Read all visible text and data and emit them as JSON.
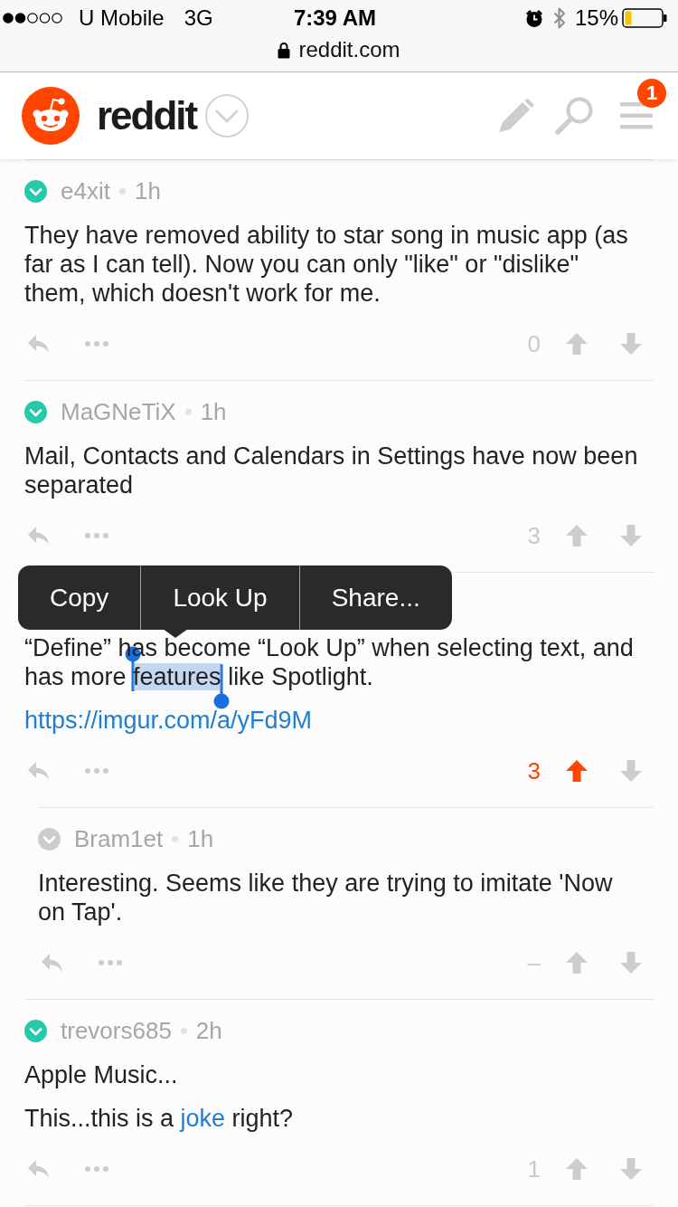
{
  "status_bar": {
    "carrier": "U Mobile",
    "network": "3G",
    "time": "7:39 AM",
    "battery": "15%"
  },
  "address_bar": {
    "url": "reddit.com"
  },
  "header": {
    "logo_text": "reddit",
    "notification_count": "1"
  },
  "comments": [
    {
      "author": "e4xit",
      "time": "1h",
      "color": "#25c9ad",
      "paragraphs": [
        {
          "parts": [
            {
              "kind": "text",
              "text": "They have removed ability to star song in music app (as far as I can tell). Now you can only \"like\" or \"dislike\" them, which doesn't work for me.",
              "selected": false
            }
          ]
        }
      ],
      "score": "0",
      "upvoted": false
    },
    {
      "author": "MaGNeTiX",
      "time": "1h",
      "color": "#25c9ad",
      "paragraphs": [
        {
          "parts": [
            {
              "kind": "text",
              "text": "Mail, Contacts and Calendars in Settings have now been separated",
              "selected": false
            }
          ]
        }
      ],
      "score": "3",
      "upvoted": false
    },
    {
      "context_menu": {
        "items": [
          "Copy",
          "Look Up",
          "Share..."
        ]
      },
      "paragraphs": [
        {
          "parts": [
            {
              "kind": "text",
              "text": "“Define” has become “Look Up” when selecting text, and has more ",
              "selected": false
            },
            {
              "kind": "text",
              "text": "features",
              "selected": true
            },
            {
              "kind": "text",
              "text": " like Spotlight.",
              "selected": false
            }
          ]
        },
        {
          "parts": [
            {
              "kind": "link",
              "text": "https://imgur.com/a/yFd9M",
              "selected": false
            }
          ]
        }
      ],
      "score": "3",
      "upvoted": true,
      "children": [
        {
          "author": "Bram1et",
          "time": "1h",
          "color": "#cccccc",
          "paragraphs": [
            {
              "parts": [
                {
                  "kind": "text",
                  "text": "Interesting. Seems like they are trying to imitate 'Now on Tap'.",
                  "selected": false
                }
              ]
            }
          ],
          "score": "–",
          "upvoted": false
        }
      ]
    },
    {
      "author": "trevors685",
      "time": "2h",
      "color": "#25c9ad",
      "paragraphs": [
        {
          "parts": [
            {
              "kind": "text",
              "text": "Apple Music...",
              "selected": false
            }
          ]
        },
        {
          "parts": [
            {
              "kind": "text",
              "text": "This...this is a ",
              "selected": false
            },
            {
              "kind": "link",
              "text": "joke",
              "selected": false
            },
            {
              "kind": "text",
              "text": " right?",
              "selected": false
            }
          ]
        }
      ],
      "score": "1",
      "upvoted": false
    }
  ]
}
